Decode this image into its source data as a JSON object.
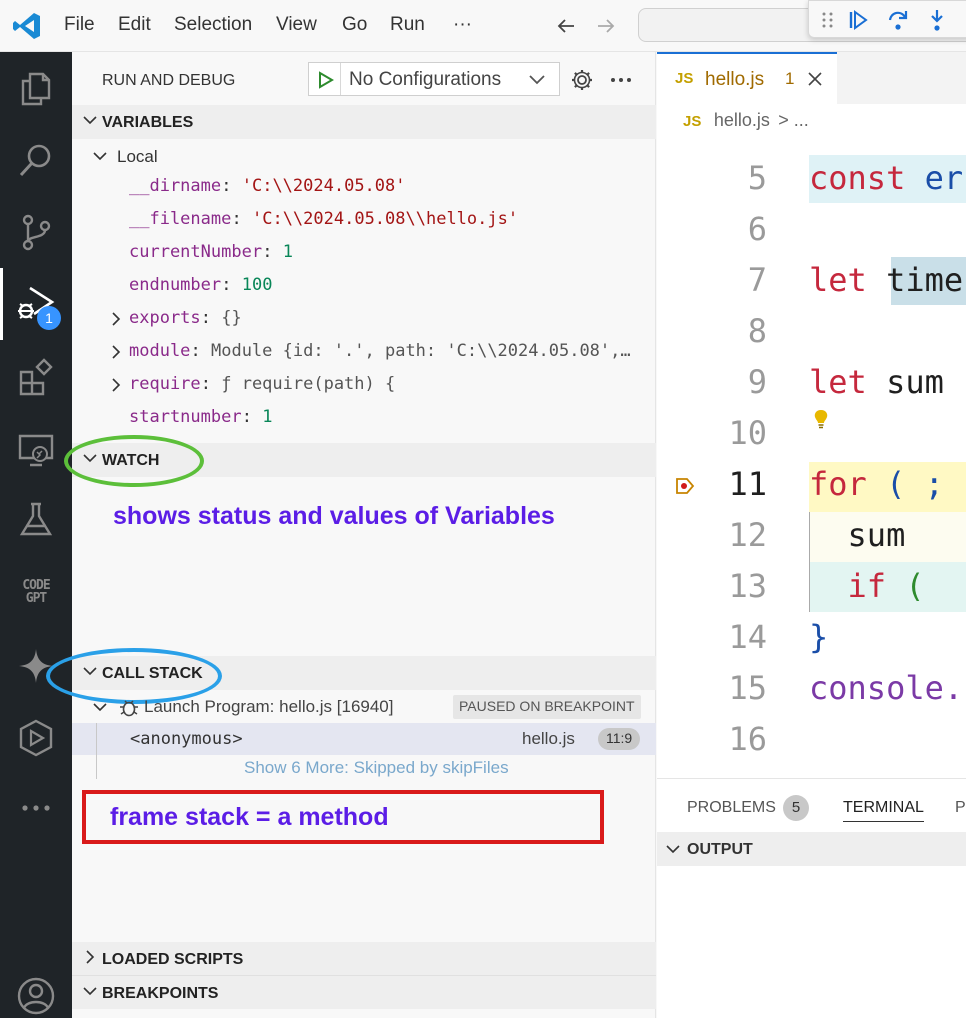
{
  "titlebar": {
    "menu": [
      "File",
      "Edit",
      "Selection",
      "View",
      "Go",
      "Run",
      "···"
    ]
  },
  "activity": {
    "debug_badge": "1",
    "codegpt_label_1": "CODE",
    "codegpt_label_2": "GPT"
  },
  "sidebar": {
    "title": "RUN AND DEBUG",
    "config": "No Configurations",
    "variables_header": "VARIABLES",
    "local_label": "Local",
    "variables": [
      {
        "name": "__dirname",
        "value": "'C:\\\\2024.05.08'",
        "kind": "str"
      },
      {
        "name": "__filename",
        "value": "'C:\\\\2024.05.08\\\\hello.js'",
        "kind": "str"
      },
      {
        "name": "currentNumber",
        "value": "1",
        "kind": "num"
      },
      {
        "name": "endnumber",
        "value": "100",
        "kind": "num"
      },
      {
        "name": "exports",
        "value": "{}",
        "kind": "obj"
      },
      {
        "name": "module",
        "value": "Module {id: '.', path: 'C:\\\\2024.05.08',…",
        "kind": "obj"
      },
      {
        "name": "require",
        "value": "ƒ require(path) {",
        "kind": "obj"
      },
      {
        "name": "startnumber",
        "value": "1",
        "kind": "num"
      }
    ],
    "watch_header": "WATCH",
    "watch_note": "shows status and values of Variables",
    "callstack_header": "CALL STACK",
    "launch_label": "Launch Program: hello.js [16940]",
    "paused_badge": "PAUSED ON BREAKPOINT",
    "frame_name": "<anonymous>",
    "frame_file": "hello.js",
    "frame_pos": "11:9",
    "show_more": "Show 6 More: Skipped by skipFiles",
    "frame_note": "frame stack = a method",
    "loaded_scripts_header": "LOADED SCRIPTS",
    "breakpoints_header": "BREAKPOINTS"
  },
  "editor": {
    "tab_icon": "JS",
    "tab_label": "hello.js",
    "tab_problems": "1",
    "breadcrumb_icon": "JS",
    "breadcrumb_file": "hello.js",
    "breadcrumb_more": "> ...",
    "lines": [
      {
        "n": "5",
        "a": "const",
        "b": " er"
      },
      {
        "n": "6",
        "a": "",
        "b": ""
      },
      {
        "n": "7",
        "a": "let",
        "b": " time"
      },
      {
        "n": "8",
        "a": "",
        "b": ""
      },
      {
        "n": "9",
        "a": "let",
        "b": " sum"
      },
      {
        "n": "10",
        "a": "",
        "b": ""
      },
      {
        "n": "11",
        "a": "for",
        "b": " ( ; ("
      },
      {
        "n": "12",
        "a": "",
        "b": "  sum"
      },
      {
        "n": "13",
        "a": "  if",
        "b": " ("
      },
      {
        "n": "14",
        "a": "",
        "b": "}"
      },
      {
        "n": "15",
        "a": "console.",
        "b": ""
      },
      {
        "n": "16",
        "a": "",
        "b": ""
      }
    ]
  },
  "panel": {
    "tab_problems": "PROBLEMS",
    "problems_count": "5",
    "tab_terminal": "TERMINAL",
    "tab_cut": "P",
    "output_header": "OUTPUT"
  },
  "colors": {
    "activity_bg": "#1f2428",
    "badge": "#3794ff",
    "annotation_text": "#5b1de6",
    "watch_circle": "#5cbf3a",
    "callstack_circle": "#2aa0e8",
    "frame_box": "#d91a1a"
  }
}
